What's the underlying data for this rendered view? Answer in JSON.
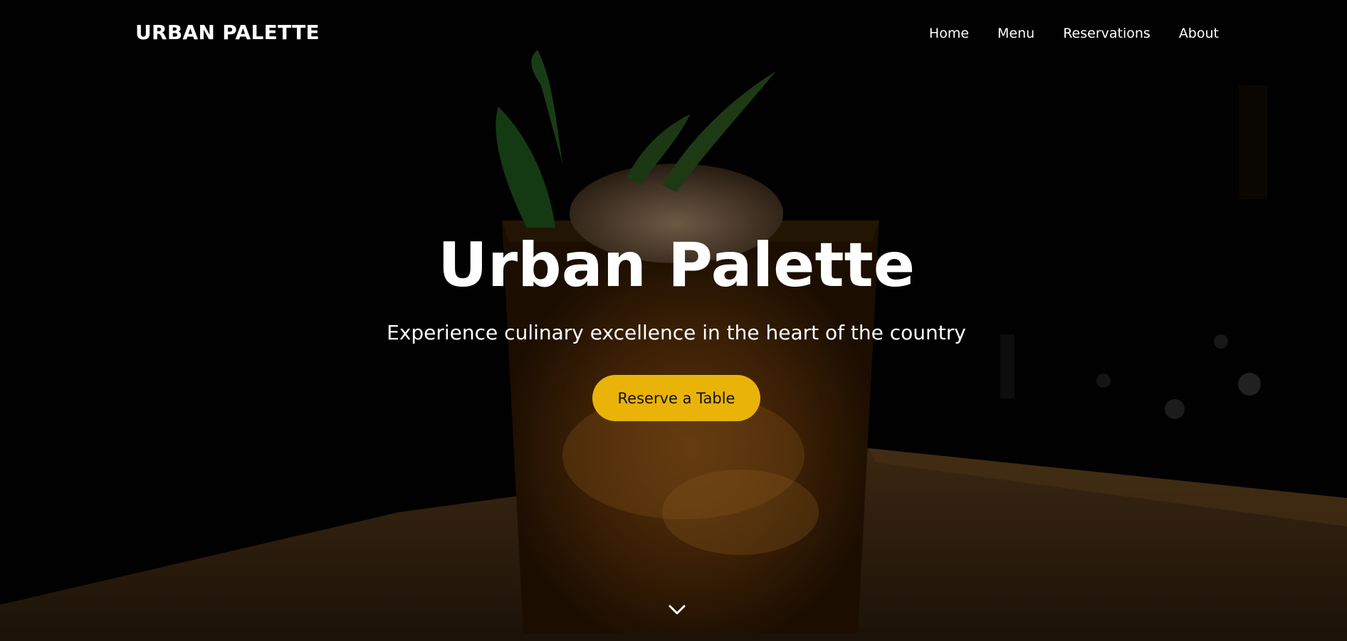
{
  "nav": {
    "brand": "URBAN PALETTE",
    "links": [
      "Home",
      "Menu",
      "Reservations",
      "About"
    ]
  },
  "hero": {
    "title": "Urban Palette",
    "subtitle": "Experience culinary excellence in the heart of the country",
    "cta_label": "Reserve a Table",
    "scroll_icon": "chevron-down-icon",
    "background_image": "cocktail-glass-photo"
  },
  "colors": {
    "accent": "#e9b308",
    "text": "#ffffff",
    "background": "#000000"
  }
}
